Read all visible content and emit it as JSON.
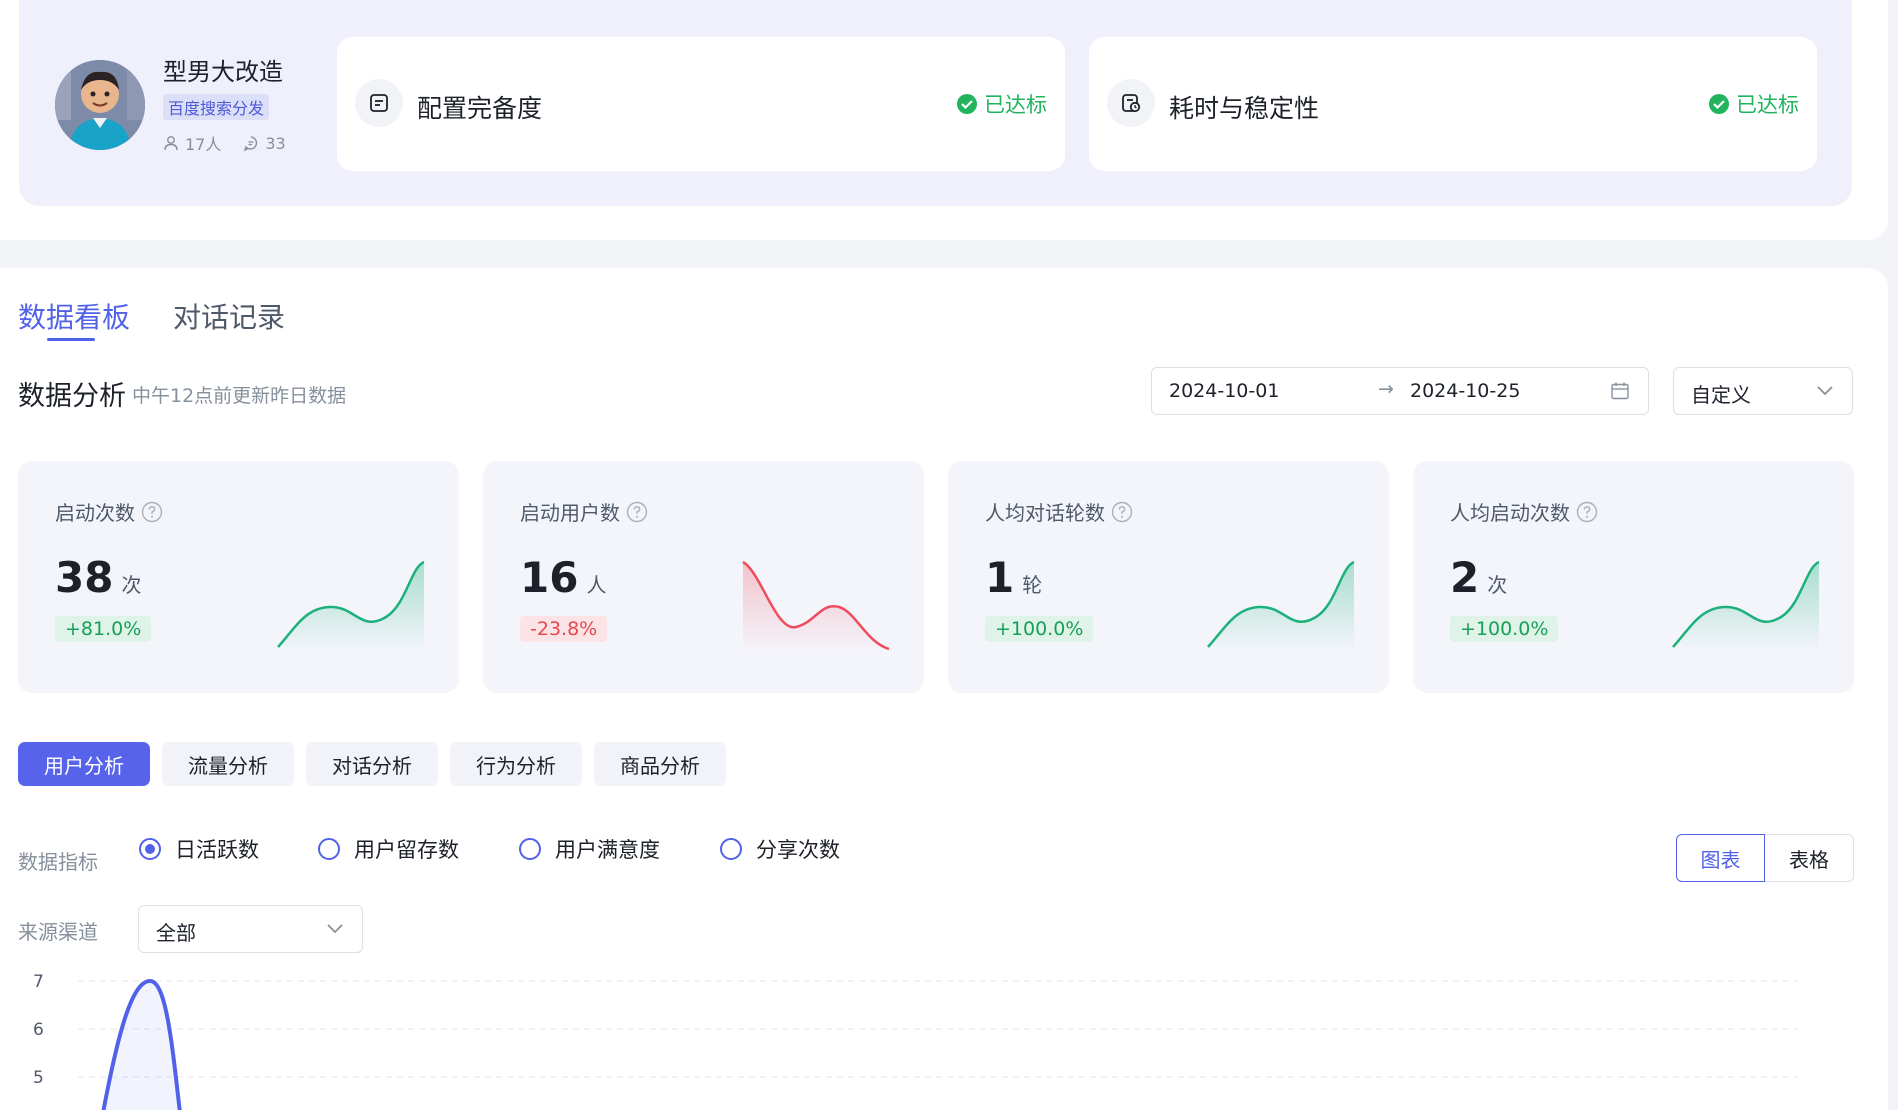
{
  "agent": {
    "name": "型男大改造",
    "tag": "百度搜索分发",
    "users": "17人",
    "messages": "33"
  },
  "status_cards": [
    {
      "title": "配置完备度",
      "status": "已达标",
      "icon": "config-doc-icon"
    },
    {
      "title": "耗时与稳定性",
      "status": "已达标",
      "icon": "stability-clock-icon"
    }
  ],
  "tabs": [
    {
      "label": "数据看板",
      "active": true
    },
    {
      "label": "对话记录",
      "active": false
    }
  ],
  "analysis": {
    "title": "数据分析",
    "subtitle": "中午12点前更新昨日数据",
    "date_start": "2024-10-01",
    "date_arrow": "→",
    "date_end": "2024-10-25",
    "preset": "自定义"
  },
  "metrics": [
    {
      "label": "启动次数",
      "value": "38",
      "unit": "次",
      "change": "+81.0%",
      "trend": "up",
      "color": "#1db17a"
    },
    {
      "label": "启动用户数",
      "value": "16",
      "unit": "人",
      "change": "-23.8%",
      "trend": "down",
      "color": "#ef4d5e"
    },
    {
      "label": "人均对话轮数",
      "value": "1",
      "unit": "轮",
      "change": "+100.0%",
      "trend": "up",
      "color": "#1db17a"
    },
    {
      "label": "人均启动次数",
      "value": "2",
      "unit": "次",
      "change": "+100.0%",
      "trend": "up",
      "color": "#1db17a"
    }
  ],
  "subtabs": [
    {
      "label": "用户分析",
      "active": true
    },
    {
      "label": "流量分析",
      "active": false
    },
    {
      "label": "对话分析",
      "active": false
    },
    {
      "label": "行为分析",
      "active": false
    },
    {
      "label": "商品分析",
      "active": false
    }
  ],
  "filters": {
    "metric_label": "数据指标",
    "metric_options": [
      {
        "label": "日活跃数",
        "checked": true
      },
      {
        "label": "用户留存数",
        "checked": false
      },
      {
        "label": "用户满意度",
        "checked": false
      },
      {
        "label": "分享次数",
        "checked": false
      }
    ],
    "view_chart": "图表",
    "view_table": "表格",
    "channel_label": "来源渠道",
    "channel_value": "全部"
  },
  "chart_data": {
    "type": "line",
    "y_ticks": [
      "7",
      "6",
      "5"
    ],
    "ylim": [
      5,
      7
    ],
    "series": [
      {
        "color": "#5262e8",
        "peak": 7
      }
    ],
    "grid": true
  },
  "colors": {
    "accent": "#5262e8",
    "success": "#22b35e",
    "danger": "#ef4d5e"
  }
}
